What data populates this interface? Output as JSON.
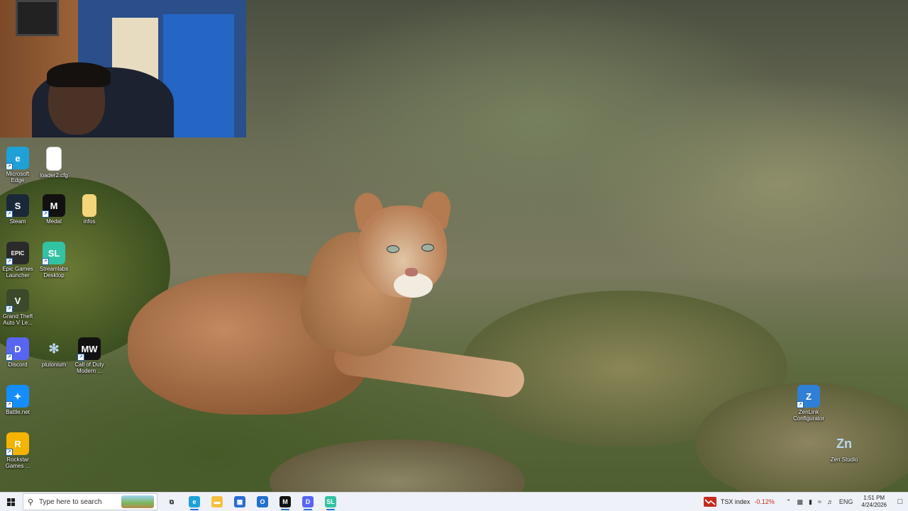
{
  "desktop": {
    "icons": [
      {
        "id": "edge",
        "label": "Microsoft Edge",
        "color": "#1fa1d8",
        "glyph": "e",
        "icon": "microsoft-edge-icon",
        "shortcut": true
      },
      {
        "id": "loader",
        "label": "loader2.cfg",
        "color": "#ffffff",
        "glyph": "",
        "icon": "file-icon",
        "shortcut": false
      },
      {
        "id": "steam",
        "label": "Steam",
        "color": "#1b2838",
        "glyph": "S",
        "icon": "steam-icon",
        "shortcut": true
      },
      {
        "id": "medal",
        "label": "Medal",
        "color": "#111111",
        "glyph": "M",
        "icon": "medal-icon",
        "shortcut": true
      },
      {
        "id": "infos",
        "label": "infos",
        "color": "#f3d57a",
        "glyph": "",
        "icon": "text-file-icon",
        "shortcut": false
      },
      {
        "id": "epic",
        "label": "Epic Games Launcher",
        "color": "#2a2a2a",
        "glyph": "EPIC",
        "icon": "epic-games-icon",
        "shortcut": true
      },
      {
        "id": "streamlabs",
        "label": "Streamlabs Desktop",
        "color": "#31c3a2",
        "glyph": "SL",
        "icon": "streamlabs-icon",
        "shortcut": true
      },
      {
        "id": "gta",
        "label": "Grand Theft Auto V Le...",
        "color": "#3b4a2a",
        "glyph": "V",
        "icon": "gta-icon",
        "shortcut": true
      },
      {
        "id": "discord",
        "label": "Discord",
        "color": "#5865f2",
        "glyph": "D",
        "icon": "discord-icon",
        "shortcut": true
      },
      {
        "id": "plutonium",
        "label": "plutonium",
        "color": "transparent",
        "glyph": "✻",
        "icon": "plutonium-icon",
        "shortcut": false
      },
      {
        "id": "cod",
        "label": "Call of Duty Modern ...",
        "color": "#111111",
        "glyph": "MW",
        "icon": "call-of-duty-icon",
        "shortcut": true
      },
      {
        "id": "battlenet",
        "label": "Battle.net",
        "color": "#148eff",
        "glyph": "✦",
        "icon": "battlenet-icon",
        "shortcut": true
      },
      {
        "id": "rockstar",
        "label": "Rockstar Games ...",
        "color": "#f4b400",
        "glyph": "R",
        "icon": "rockstar-icon",
        "shortcut": true
      },
      {
        "id": "zenlink",
        "label": "ZenLink Configurator",
        "color": "#2f7fd6",
        "glyph": "Z",
        "icon": "zenlink-icon",
        "shortcut": true
      },
      {
        "id": "zenstudio",
        "label": "Zen Studio",
        "color": "transparent",
        "glyph": "Zn",
        "icon": "zen-studio-icon",
        "shortcut": false
      }
    ]
  },
  "taskbar": {
    "search_placeholder": "Type here to search",
    "apps": [
      {
        "name": "task-view-button",
        "icon": "task-view-icon",
        "color": "#333333",
        "glyph": "⧉",
        "active": false
      },
      {
        "name": "taskbar-edge",
        "icon": "microsoft-edge-icon",
        "color": "#1fa1d8",
        "glyph": "e",
        "active": true
      },
      {
        "name": "taskbar-file-explorer",
        "icon": "folder-icon",
        "color": "#f3c140",
        "glyph": "▬",
        "active": false
      },
      {
        "name": "taskbar-store",
        "icon": "microsoft-store-icon",
        "color": "#2b6cd4",
        "glyph": "▦",
        "active": false
      },
      {
        "name": "taskbar-outlook",
        "icon": "outlook-icon",
        "color": "#1f6fd0",
        "glyph": "O",
        "active": false
      },
      {
        "name": "taskbar-medal",
        "icon": "medal-icon",
        "color": "#111111",
        "glyph": "M",
        "active": true
      },
      {
        "name": "taskbar-discord",
        "icon": "discord-icon",
        "color": "#5865f2",
        "glyph": "D",
        "active": true
      },
      {
        "name": "taskbar-streamlabs",
        "icon": "streamlabs-icon",
        "color": "#31c3a2",
        "glyph": "SL",
        "active": true
      }
    ],
    "stock": {
      "label": "TSX index",
      "change": "-0.12%",
      "icon": "stock-chart-icon"
    },
    "tray_icons": [
      "chevron-up-icon",
      "network-icon",
      "microphone-icon",
      "wifi-icon",
      "volume-icon"
    ],
    "language": "ENG",
    "time": "1:51 PM",
    "date": "4/24/2026"
  }
}
